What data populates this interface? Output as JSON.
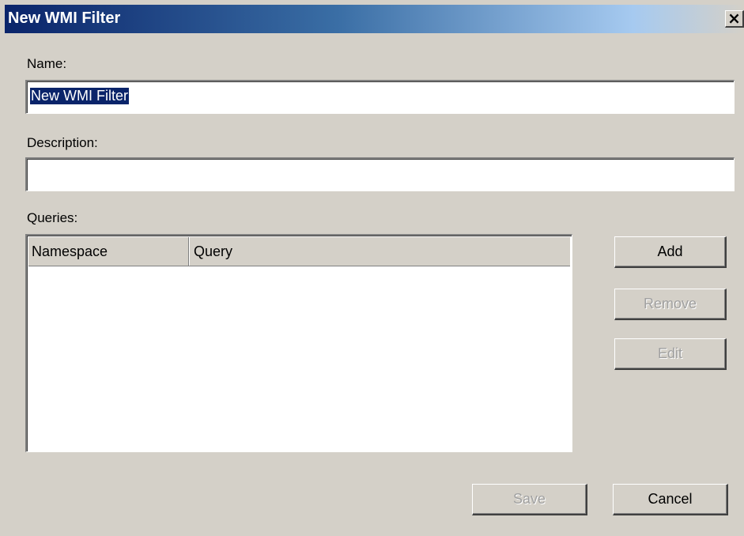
{
  "window": {
    "title": "New WMI Filter",
    "close_glyph": "✕"
  },
  "form": {
    "name_label": "Name:",
    "name_value": "New WMI Filter",
    "description_label": "Description:",
    "description_value": "",
    "queries_label": "Queries:"
  },
  "queries_table": {
    "columns": [
      "Namespace",
      "Query"
    ],
    "rows": []
  },
  "buttons": {
    "add": "Add",
    "remove": "Remove",
    "edit": "Edit",
    "save": "Save",
    "cancel": "Cancel"
  },
  "colors": {
    "dialog_bg": "#d4d0c8",
    "titlebar_start": "#0a246a",
    "selection": "#0a246a",
    "disabled_text": "#a0a0a0"
  }
}
